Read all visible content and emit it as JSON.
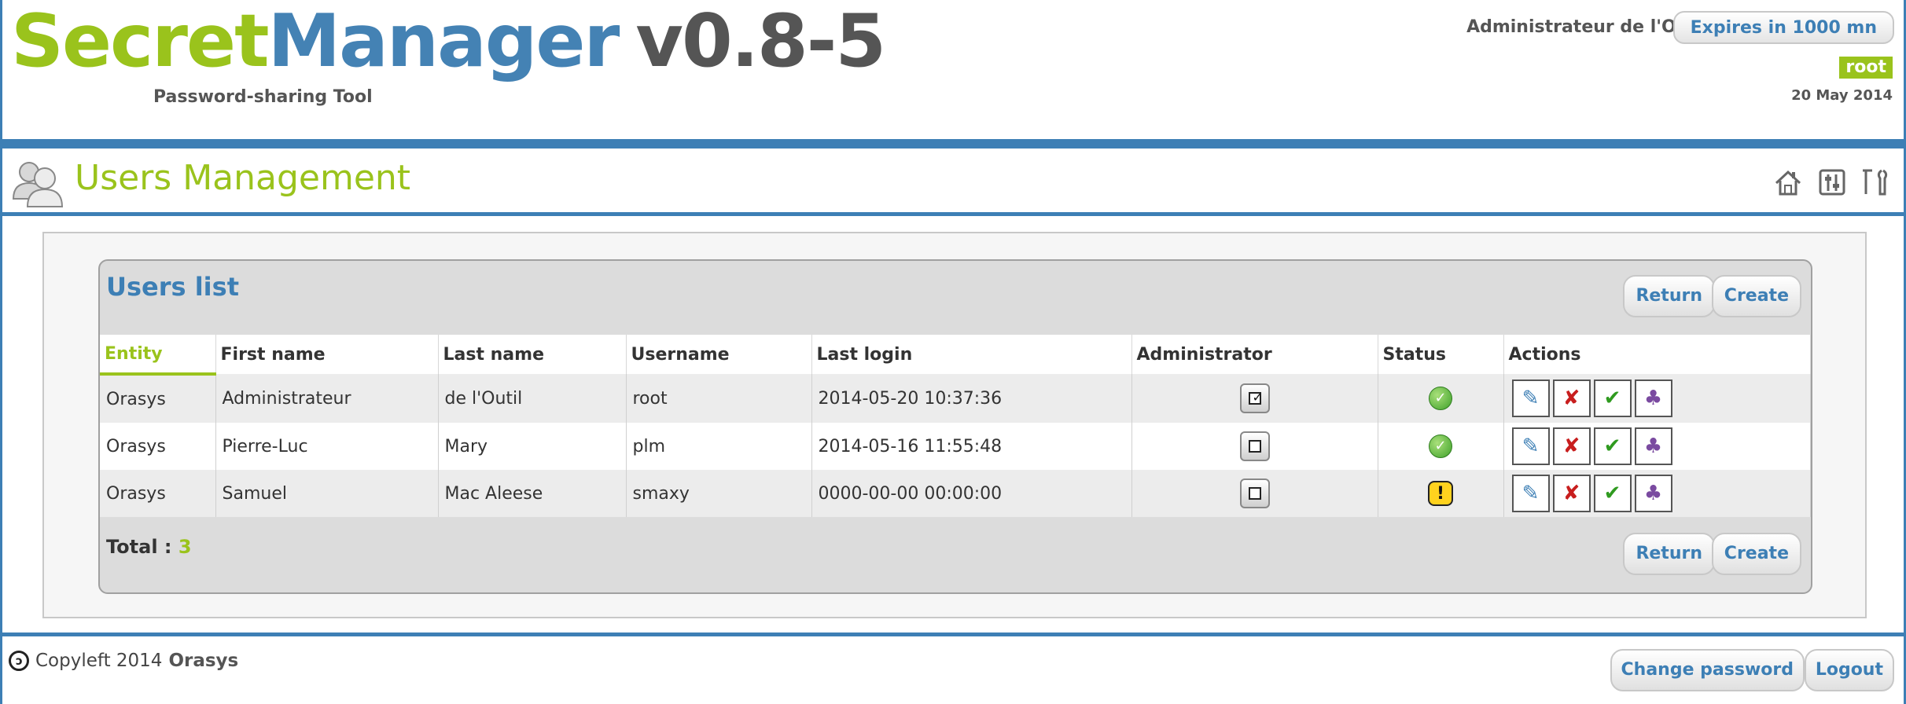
{
  "header": {
    "logo_secret": "Secret",
    "logo_manager": "Manager",
    "logo_version": "v0.8-5",
    "tagline": "Password-sharing Tool",
    "admin_name": "Administrateur de l'Outil",
    "expires_label": "Expires in 1000 mn",
    "username_badge": "root",
    "date": "20 May 2014"
  },
  "section": {
    "title": "Users Management",
    "icons": [
      "home-icon",
      "preferences-icon",
      "tools-icon"
    ]
  },
  "panel": {
    "title": "Users list",
    "return_label": "Return",
    "create_label": "Create",
    "columns": [
      "Entity",
      "First name",
      "Last name",
      "Username",
      "Last login",
      "Administrator",
      "Status",
      "Actions"
    ],
    "active_column": "Entity",
    "rows": [
      {
        "entity": "Orasys",
        "first_name": "Administrateur",
        "last_name": "de l'Outil",
        "username": "root",
        "last_login": "2014-05-20 10:37:36",
        "administrator": true,
        "status": "ok"
      },
      {
        "entity": "Orasys",
        "first_name": "Pierre-Luc",
        "last_name": "Mary",
        "username": "plm",
        "last_login": "2014-05-16 11:55:48",
        "administrator": false,
        "status": "ok"
      },
      {
        "entity": "Orasys",
        "first_name": "Samuel",
        "last_name": "Mac Aleese",
        "username": "smaxy",
        "last_login": "0000-00-00 00:00:00",
        "administrator": false,
        "status": "warning"
      }
    ],
    "action_icons": [
      "edit-user-icon",
      "delete-user-icon",
      "activate-user-icon",
      "user-groups-icon"
    ],
    "total_label": "Total :",
    "total_value": "3"
  },
  "footer": {
    "copyleft_text": "Copyleft 2014",
    "organization": "Orasys",
    "change_password_label": "Change password",
    "logout_label": "Logout"
  },
  "colors": {
    "brand_green": "#9ac31c",
    "brand_blue": "#3d7fb5",
    "status_ok": "#3fa12a",
    "status_warning": "#ffd21e"
  }
}
